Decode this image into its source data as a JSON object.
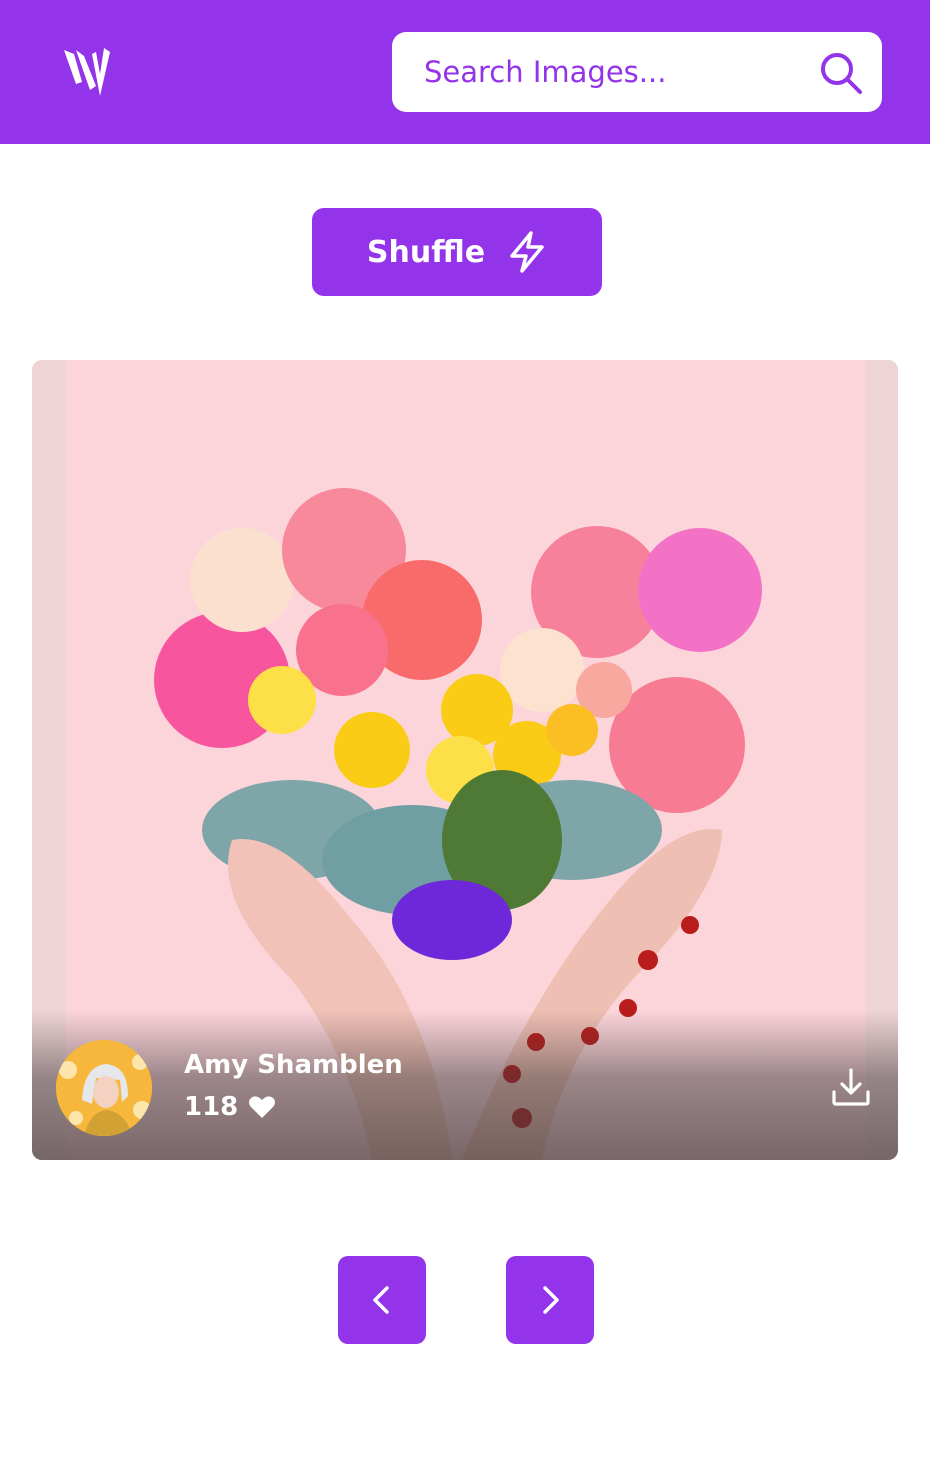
{
  "header": {
    "logo_icon": "brand-logo",
    "search": {
      "placeholder": "Search Images...",
      "value": "",
      "icon": "search-icon"
    }
  },
  "shuffle": {
    "label": "Shuffle",
    "icon": "bolt-icon"
  },
  "photo": {
    "subject": "heart-shaped flower bouquet held by hands",
    "author": {
      "name": "Amy Shamblen",
      "avatar_icon": "avatar"
    },
    "likes": {
      "count": "118",
      "icon": "heart-icon"
    },
    "download_icon": "download-icon"
  },
  "pagination": {
    "prev_icon": "chevron-left-icon",
    "next_icon": "chevron-right-icon"
  },
  "colors": {
    "accent": "#9333ea",
    "background": "#ffffff",
    "photo_background": "#fbd4d9"
  }
}
